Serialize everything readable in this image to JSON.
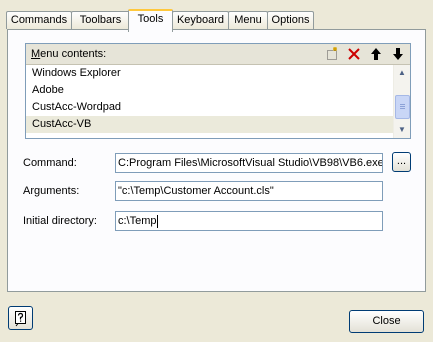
{
  "tabs": [
    "Commands",
    "Toolbars",
    "Tools",
    "Keyboard",
    "Menu",
    "Options"
  ],
  "active_tab": "Tools",
  "menu_contents": {
    "label_accel": "M",
    "label_rest": "enu contents:",
    "toolbar_icons": [
      "new-item-icon",
      "delete-icon",
      "move-up-icon",
      "move-down-icon"
    ],
    "items": [
      "Windows Explorer",
      "Adobe",
      "CustAcc-Wordpad",
      "CustAcc-VB"
    ],
    "selected_index": 3
  },
  "command": {
    "label": "Command:",
    "value": "C:Program Files\\MicrosoftVisual Studio\\VB98\\VB6.exe",
    "browse_label": "..."
  },
  "arguments": {
    "label": "Arguments:",
    "value": "\"c:\\Temp\\Customer Account.cls\""
  },
  "initial_directory": {
    "label": "Initial directory:",
    "value": "c:\\Temp"
  },
  "close_label": "Close",
  "colors": {
    "delete_icon": "#cc0000",
    "selection": "#ebeadb",
    "tab_highlight": "#ffc83c"
  }
}
